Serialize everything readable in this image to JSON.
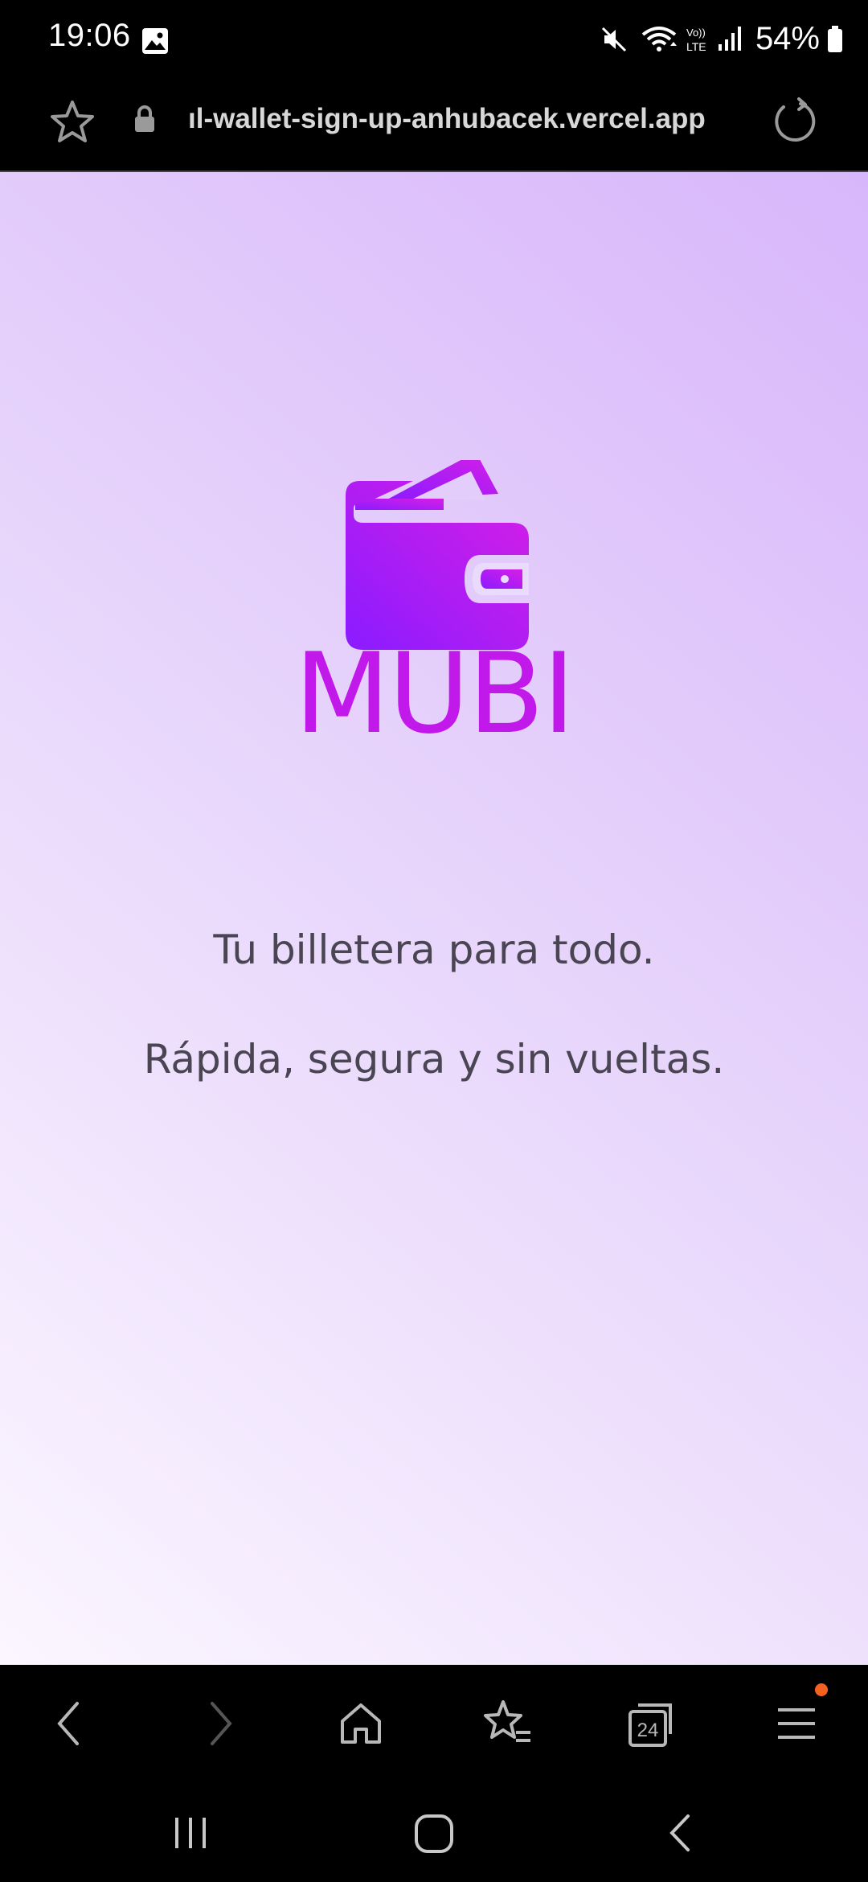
{
  "status_bar": {
    "time": "19:06",
    "battery": "54%",
    "icons": [
      "gallery-icon",
      "mute-icon",
      "wifi-icon",
      "volte-icon",
      "signal-icon",
      "battery-icon"
    ]
  },
  "browser": {
    "url": "ıl-wallet-sign-up-anhubacek.vercel.app",
    "tabs_count": "24"
  },
  "page": {
    "brand": "MUBI",
    "tagline": "Tu billetera para todo.",
    "subtagline": "Rápida, segura y sin vueltas."
  },
  "colors": {
    "brand": "#c019ea",
    "wallet_gradient_start": "#8a1cff",
    "wallet_gradient_end": "#d71ee6",
    "background_accent": "#d8b6fb",
    "menu_badge": "#f5621f"
  }
}
